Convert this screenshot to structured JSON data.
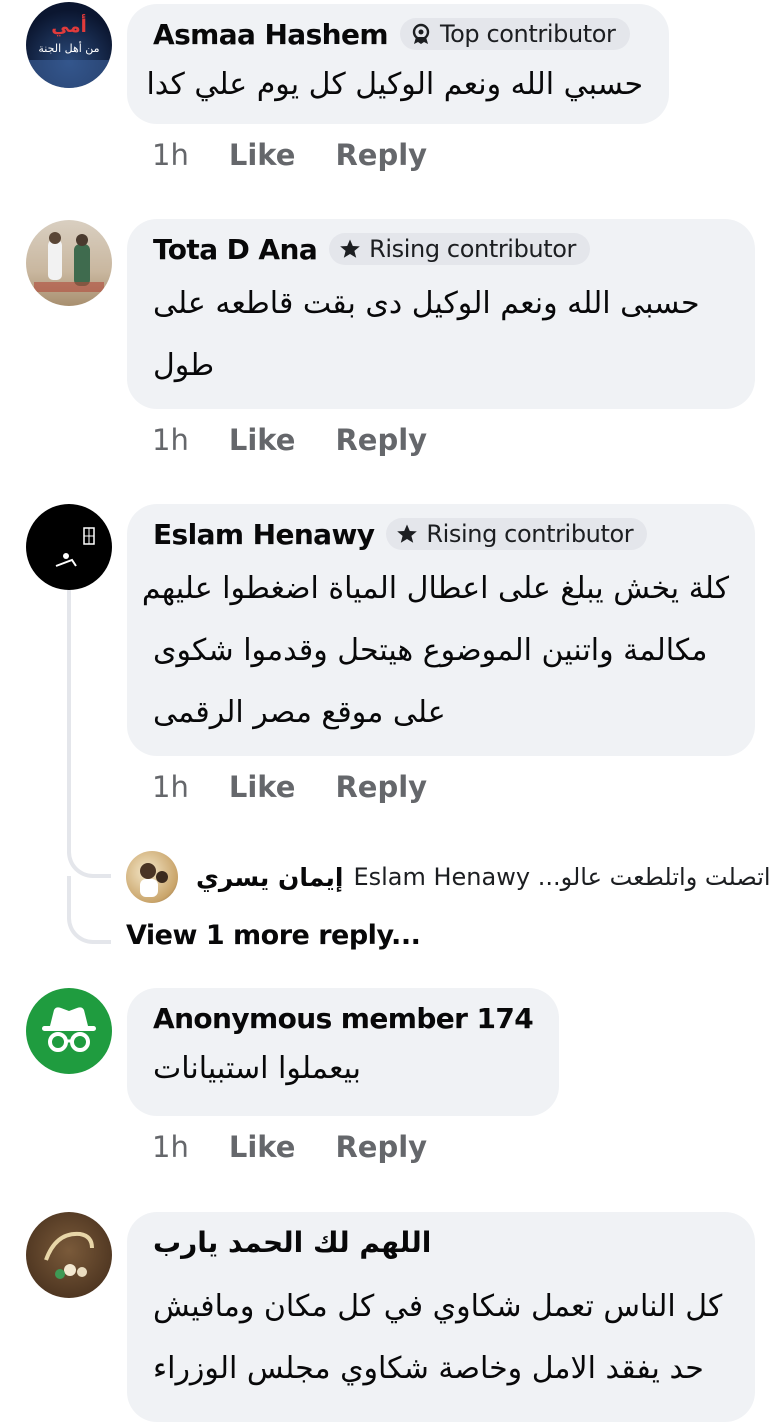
{
  "comments": [
    {
      "author": "Asmaa Hashem",
      "badge": "Top contributor",
      "badge_icon": "award-icon",
      "avatar_text": "أمي من أهل الجنة",
      "text_lines": [
        "حسبي الله ونعم الوكيل كل يوم علي كدا"
      ],
      "time": "1h",
      "like": "Like",
      "reply": "Reply"
    },
    {
      "author": "Tota D Ana",
      "badge": "Rising contributor",
      "badge_icon": "star-icon",
      "text_lines": [
        "حسبى الله ونعم الوكيل دى بقت قاطعه على",
        "طول"
      ],
      "time": "1h",
      "like": "Like",
      "reply": "Reply"
    },
    {
      "author": "Eslam Henawy",
      "badge": "Rising contributor",
      "badge_icon": "star-icon",
      "text_lines": [
        "كلة يخش يبلغ على اعطال المياة اضغطوا عليهم",
        "مكالمة واتنين الموضوع هيتحل وقدموا شكوى",
        "على موقع مصر الرقمى"
      ],
      "time": "1h",
      "like": "Like",
      "reply": "Reply",
      "nested_reply": {
        "author": "إيمان يسري",
        "preview": "Eslam Henawy اتصلت واتلطعت عالو...",
        "mention": "Eslam Henawy",
        "preview_text": "اتصلت واتلطعت عالو..."
      },
      "view_more": "View 1 more reply..."
    },
    {
      "author": "Anonymous member 174",
      "avatar_icon": "anonymous-icon",
      "text_lines": [
        "بيعملوا استبيانات"
      ],
      "time": "1h",
      "like": "Like",
      "reply": "Reply"
    },
    {
      "author": "اللهم لك الحمد يارب",
      "text_lines": [
        "كل الناس تعمل شكاوي في كل مكان ومافيش",
        "حد يفقد الامل وخاصة شكاوي مجلس الوزراء"
      ]
    }
  ],
  "colors": {
    "bubble": "#f0f2f5",
    "badge": "#e4e6eb",
    "meta_text": "#65676b",
    "anon_green": "#1f9c3f"
  }
}
